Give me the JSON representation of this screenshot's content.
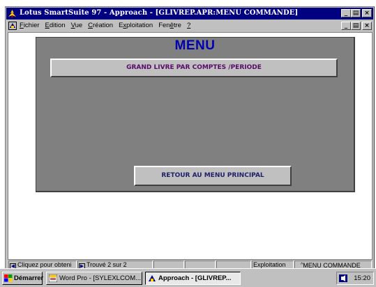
{
  "window": {
    "app_name": "Lotus SmartSuite 97",
    "title_rest": "  -  Approach - [GLIVREP.APR:MENU COMMANDE]"
  },
  "menubar": {
    "items": [
      "Fichier",
      "Edition",
      "Vue",
      "Création",
      "Exploitation",
      "Fenêtre",
      "?"
    ],
    "underline": [
      "F",
      "E",
      "V",
      "C",
      "x",
      "ê",
      "?"
    ]
  },
  "form": {
    "title": "MENU",
    "button_grand": "GRAND LIVRE PAR COMPTES /PERIODE",
    "button_retour": "RETOUR AU MENU PRINCIPAL"
  },
  "statusbar": {
    "hint": "Cliquez pour obteni",
    "found": "Trouvé 2 sur 2",
    "mode": "Exploitation",
    "view": "MENU COMMANDE"
  },
  "taskbar": {
    "start": "Démarrer",
    "tasks": [
      "Word Pro - [SYLEXLCOM...",
      "Approach - [GLIVREP..."
    ],
    "clock": "15:20"
  },
  "colors": {
    "titlebar": "#000080",
    "form_title": "#0000b0",
    "form_bg": "#808080",
    "chrome": "#c0c0c0"
  },
  "icons": {
    "app": "lotus-app-icon",
    "doc": "approach-document-icon",
    "start": "windows-logo-icon",
    "wordpro": "word-pro-icon",
    "approach": "approach-icon",
    "tray": "speaker-tray-icon"
  }
}
